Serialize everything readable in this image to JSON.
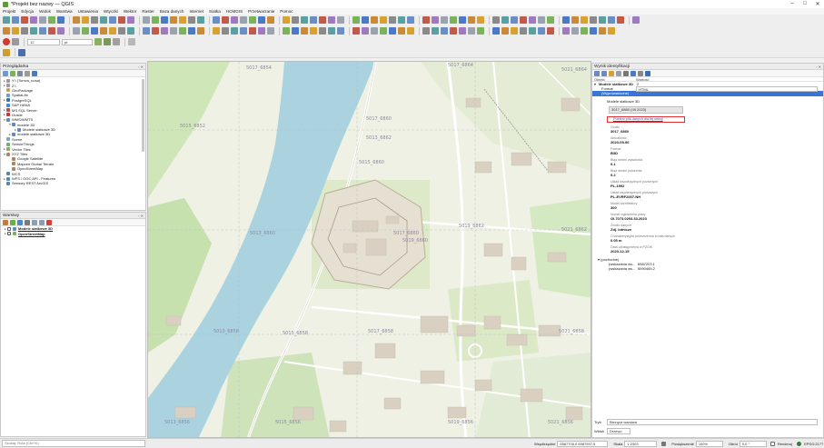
{
  "window": {
    "title": "*Projekt bez nazwy — QGIS",
    "minimize": "–",
    "maximize": "□",
    "close": "✕"
  },
  "menu": [
    "Projekt",
    "Edycja",
    "Widok",
    "Warstwa",
    "Ustawienia",
    "Wtyczki",
    "Wektor",
    "Raster",
    "Baza danych",
    "Internet",
    "Siatka",
    "HCMGIS",
    "Przetwarzanie",
    "Pomoc"
  ],
  "toolbar": {
    "font_size": "12",
    "font_unit": "pt"
  },
  "browser": {
    "title": "Przeglądarka",
    "items": [
      {
        "label": "Y:\\ (Tomca_nosa)",
        "indent": 0,
        "arrow": "▸",
        "color": "#9a9a9a"
      },
      {
        "label": "Z:\\",
        "indent": 0,
        "arrow": "▸",
        "color": "#9a9a9a"
      },
      {
        "label": "GeoPackage",
        "indent": 0,
        "arrow": "",
        "color": "#c6a15a"
      },
      {
        "label": "SpatiaLite",
        "indent": 0,
        "arrow": "",
        "color": "#6aa0c8"
      },
      {
        "label": "PostgreSQL",
        "indent": 0,
        "arrow": "▸",
        "color": "#3f6fa8"
      },
      {
        "label": "SAP HANA",
        "indent": 0,
        "arrow": "",
        "color": "#3d8bd9"
      },
      {
        "label": "MS SQL Server",
        "indent": 0,
        "arrow": "▸",
        "color": "#a55"
      },
      {
        "label": "Oracle",
        "indent": 0,
        "arrow": "▸",
        "color": "#c33"
      },
      {
        "label": "WMS/WMTS",
        "indent": 0,
        "arrow": "▾",
        "color": "#5a8bc4"
      },
      {
        "label": "modele 3D",
        "indent": 1,
        "arrow": "▾",
        "color": "#5a8bc4"
      },
      {
        "label": "Modele siatkowe 3D",
        "indent": 2,
        "arrow": "▸",
        "color": "#5a8bc4"
      },
      {
        "label": "modele siatkowe 3D",
        "indent": 1,
        "arrow": "▸",
        "color": "#5a8bc4"
      },
      {
        "label": "Scene",
        "indent": 0,
        "arrow": "",
        "color": "#7aa"
      },
      {
        "label": "SensorThings",
        "indent": 0,
        "arrow": "",
        "color": "#7a7"
      },
      {
        "label": "Vector Tiles",
        "indent": 0,
        "arrow": "▸",
        "color": "#8a6"
      },
      {
        "label": "XYZ Tiles",
        "indent": 0,
        "arrow": "▾",
        "color": "#a86"
      },
      {
        "label": "Google Satellite",
        "indent": 1,
        "arrow": "",
        "color": "#a86"
      },
      {
        "label": "Mapzen Global Terrain",
        "indent": 1,
        "arrow": "",
        "color": "#a86"
      },
      {
        "label": "OpenStreetMap",
        "indent": 1,
        "arrow": "",
        "color": "#a86"
      },
      {
        "label": "WCS",
        "indent": 0,
        "arrow": "",
        "color": "#58a"
      },
      {
        "label": "WFS / OGC API - Features",
        "indent": 0,
        "arrow": "▸",
        "color": "#58a"
      },
      {
        "label": "Sensory REST ArcGIS",
        "indent": 0,
        "arrow": "",
        "color": "#58a"
      }
    ]
  },
  "layers": {
    "title": "Warstwy",
    "items": [
      {
        "label": "Modele siatkowe 3D"
      },
      {
        "label": "OpenStreetMap"
      }
    ]
  },
  "identify": {
    "title": "Wynik identyfikacji",
    "col_object": "Obiekt",
    "col_value": "Wartość",
    "layer": "Modele siatkowe 3D",
    "layer_count": "2",
    "format_label": "Format",
    "format_value": "HTML",
    "selected_row": "(Wyprowadzone)",
    "group_label": "Modele siatkowe 3D",
    "combo_value": "3017_6860 (IIII 2023)",
    "link_text": "Pobierz plik danych dla tej sekcji",
    "fields": [
      {
        "label": "Godło",
        "value": "3017_6860"
      },
      {
        "label": "Aktualność",
        "value": "2023-09-06"
      },
      {
        "label": "Format",
        "value": "B3D"
      },
      {
        "label": "Błąd średni wysokości",
        "value": "0.1"
      },
      {
        "label": "Błąd średni położenia",
        "value": "0.2"
      },
      {
        "label": "Układ współrzędnych poziomych",
        "value": "PL-1992"
      },
      {
        "label": "Układ współrzędnych pionowych",
        "value": "PL-EVRF2007-NH"
      },
      {
        "label": "Model architektury",
        "value": "300"
      },
      {
        "label": "Numer zgłoszenia pracy",
        "value": "GI.7073.0293.33.2023"
      },
      {
        "label": "Źródło danych",
        "value": "Zdj. lotnicze"
      },
      {
        "label": "Charakterystyka przestrzenna źródła danych",
        "value": "0.05 m"
      },
      {
        "label": "Data udostępnienia w PZGiK",
        "value": "2023-12-15"
      }
    ],
    "derived_label": "(pochodne)",
    "derived": [
      {
        "label": "(wskazania ws...",
        "value": "6587203.1"
      },
      {
        "label": "(wskazania ws...",
        "value": "5590465.2"
      }
    ],
    "mode_label": "Tryb",
    "mode_value": "Bieżąca warstwa",
    "view_label": "Widok",
    "view_value": "Drzewo"
  },
  "map": {
    "sheet_labels": [
      "5017_6854",
      "5015_6852",
      "5017_6860",
      "5013_6862",
      "5015_6860",
      "5019_6862",
      "5013_6860",
      "5017_6860",
      "5019_6860",
      "5021_6862",
      "5013_6858",
      "5015_6858",
      "5017_6858",
      "5021_6858",
      "5013_6856",
      "5015_6856",
      "5019_6856",
      "5021_6856",
      "5017_6864",
      "5021_6864"
    ],
    "colors": {
      "land": "#eef1e4",
      "water": "#a9d3df",
      "green": "#c8e2b0",
      "building": "#d8d0c3",
      "road": "#ffffff"
    }
  },
  "statusbar": {
    "search_placeholder": "Szukaj: Ruta (Ctrl+K)",
    "coord_label": "Współrzędne",
    "coord_value": "6587705,0 6987597,5",
    "scale_label": "Skala",
    "scale_value": "1:2303",
    "lock_label": "Powiększenie",
    "zoom_value": "100%",
    "rotation_label": "Obrót",
    "rotation_value": "0,0 °",
    "render_label": "Renderuj",
    "crs": "EPSG:2177"
  }
}
